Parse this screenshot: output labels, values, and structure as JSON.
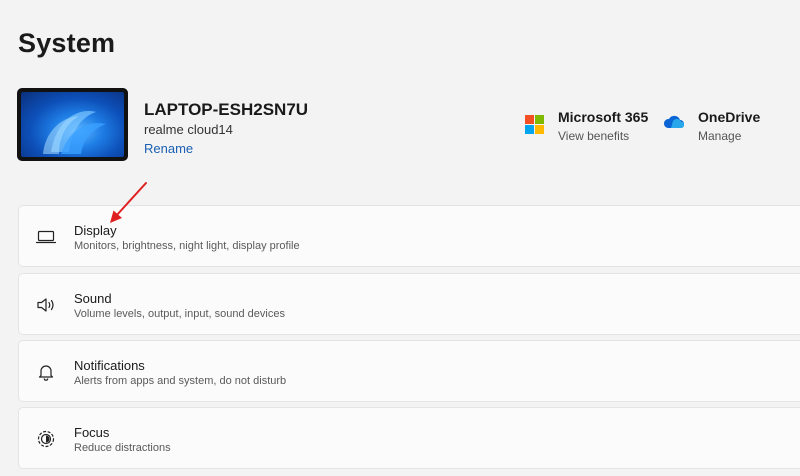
{
  "page": {
    "title": "System"
  },
  "device": {
    "name": "LAPTOP-ESH2SN7U",
    "model": "realme cloud14",
    "rename_label": "Rename"
  },
  "services": [
    {
      "title": "Microsoft 365",
      "subtitle": "View benefits",
      "icon": "microsoft-logo-icon"
    },
    {
      "title": "OneDrive",
      "subtitle": "Manage",
      "icon": "onedrive-cloud-icon"
    }
  ],
  "settings": [
    {
      "title": "Display",
      "description": "Monitors, brightness, night light, display profile",
      "icon": "laptop-icon"
    },
    {
      "title": "Sound",
      "description": "Volume levels, output, input, sound devices",
      "icon": "speaker-icon"
    },
    {
      "title": "Notifications",
      "description": "Alerts from apps and system, do not disturb",
      "icon": "bell-icon"
    },
    {
      "title": "Focus",
      "description": "Reduce distractions",
      "icon": "focus-icon"
    }
  ],
  "colors": {
    "link": "#1a5fb4",
    "annotation_arrow": "#e02020"
  }
}
